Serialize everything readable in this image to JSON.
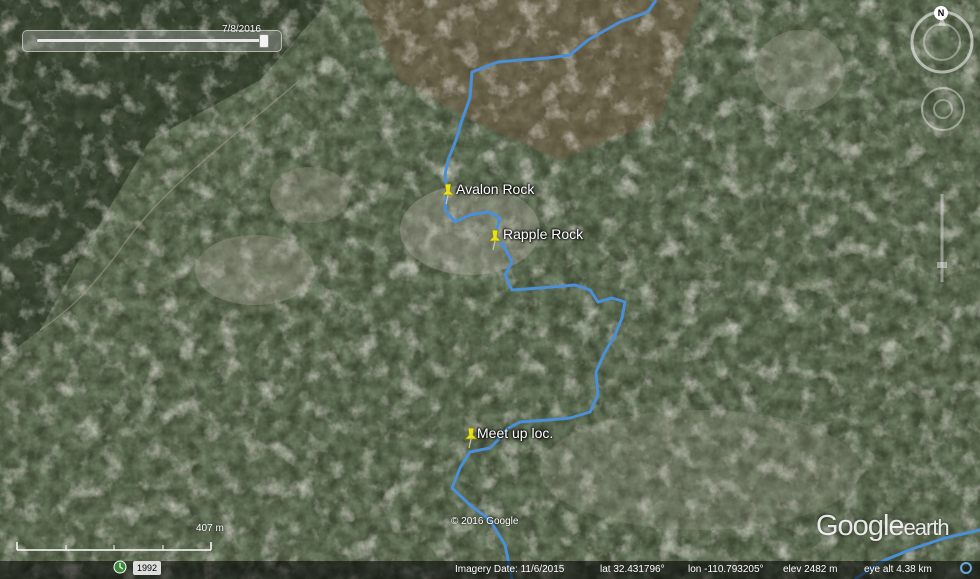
{
  "app": {
    "name": "Google Earth"
  },
  "placemarks": [
    {
      "id": "avalon",
      "label": "Avalon Rock"
    },
    {
      "id": "rapple",
      "label": "Rapple Rock"
    },
    {
      "id": "meetup",
      "label": "Meet up loc."
    }
  ],
  "timeslider": {
    "date": "7/8/2016"
  },
  "compass": {
    "north_label": "N"
  },
  "scale": {
    "label": "407 m"
  },
  "copyright": "© 2016 Google",
  "logo": {
    "google": "Google",
    "earth": "earth"
  },
  "statusbar": {
    "year": "1992",
    "imagery_date": "Imagery Date: 11/6/2015",
    "lat": "lat   32.431796°",
    "lon": "lon  -110.793205°",
    "elev": "elev  2482 m",
    "eye_alt": "eye alt   4.38 km"
  },
  "colors": {
    "route": "#4a8fd8",
    "pin": "#e8e020",
    "label_text": "#ffffff"
  },
  "icons": [
    "pushpin-icon",
    "compass-icon",
    "look-control-icon",
    "zoom-slider-icon",
    "history-icon",
    "streaming-status-icon"
  ]
}
